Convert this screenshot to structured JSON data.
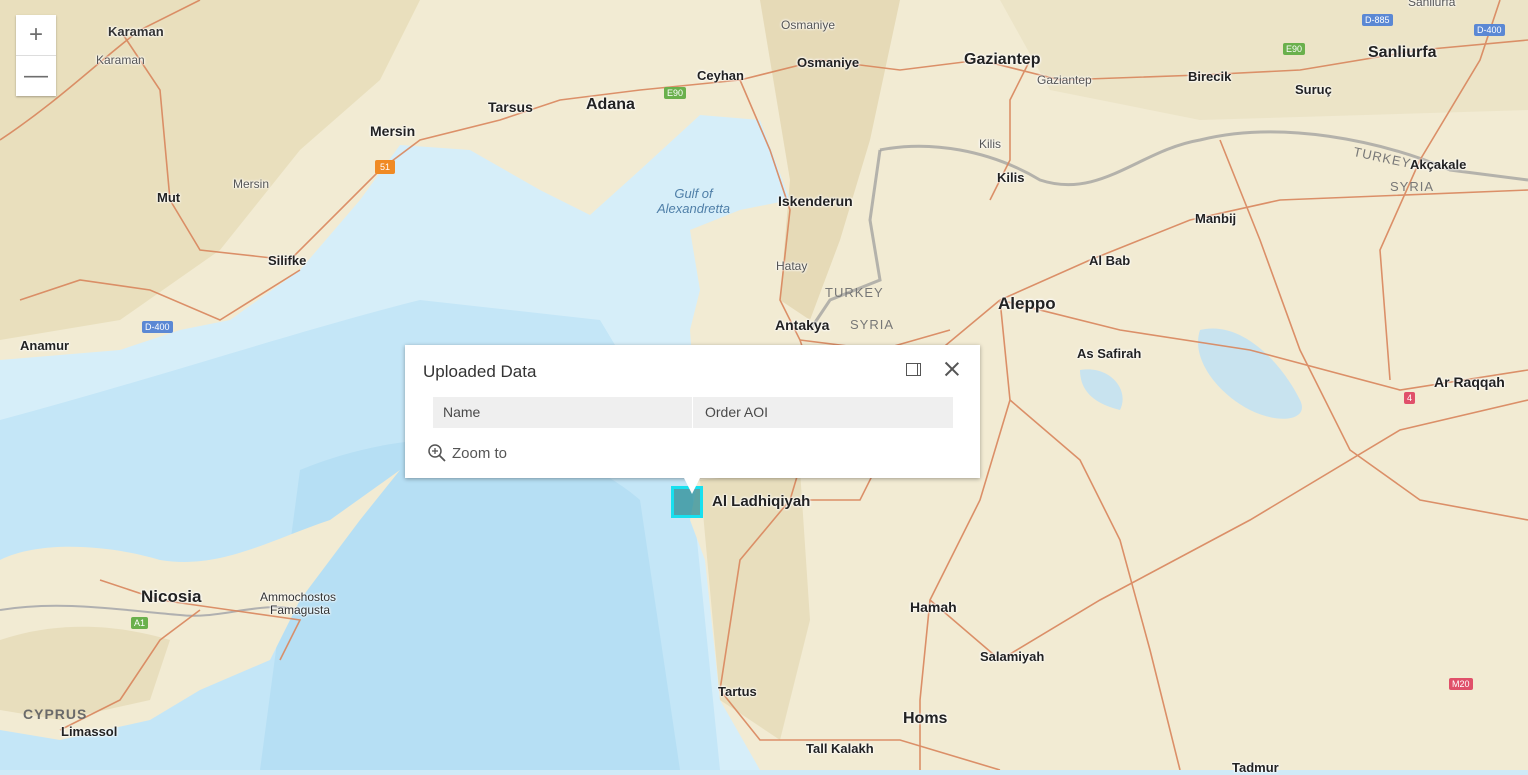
{
  "map": {
    "colors": {
      "land": "#f3ecd5",
      "sea": "#d6eef9",
      "deep_sea": "#b8e0f5",
      "road": "#d9865d",
      "mountain": "#e0d4b0",
      "border": "#9a9a9a",
      "aoi_fill": "#2a8c96",
      "aoi_outline": "#18e0ef"
    },
    "labels": {
      "karaman": "Karaman",
      "karaman_sub": "Karaman",
      "mersin": "Mersin",
      "mersin_sub": "Mersin",
      "tarsus": "Tarsus",
      "adana": "Adana",
      "ceyhan": "Ceyhan",
      "osmaniye_sub": "Osmaniye",
      "osmaniye": "Osmaniye",
      "gaziantep": "Gaziantep",
      "gaziantep_sub": "Gaziantep",
      "birecik": "Birecik",
      "sanliurfa": "Sanliurfa",
      "sanliurfa_sub": "Sanliurfa",
      "suruc": "Suruç",
      "mut": "Mut",
      "silifke": "Silifke",
      "anamur": "Anamur",
      "iskenderun": "Iskenderun",
      "hatay": "Hatay",
      "kilis_sub": "Kilis",
      "kilis": "Kilis",
      "turkey_east": "TURKEY",
      "akcakale": "Akçakale",
      "syria_east": "SYRIA",
      "manbij": "Manbij",
      "al_bab": "Al Bab",
      "aleppo": "Aleppo",
      "antakya": "Antakya",
      "turkey_mid": "TURKEY",
      "syria_mid": "SYRIA",
      "as_safirah": "As Safirah",
      "ar_raqqah": "Ar Raqqah",
      "al_ladhiqiyah": "Al Ladhiqiyah",
      "hamah": "Hamah",
      "salamiyah": "Salamiyah",
      "nicosia": "Nicosia",
      "ammochostos": "Ammochostos",
      "famagusta": "Famagusta",
      "cyprus": "CYPRUS",
      "limassol": "Limassol",
      "tartus": "Tartus",
      "homs": "Homs",
      "tall_kalakh": "Tall Kalakh",
      "tadmur": "Tadmur",
      "gulf_line1": "Gulf of",
      "gulf_line2": "Alexandretta"
    },
    "shields": {
      "d885": "D-885",
      "d400_ne": "D-400",
      "e90_ne": "E90",
      "e90_adana": "E90",
      "r51": "51",
      "d400_w": "D-400",
      "r4": "4",
      "m20": "M20",
      "a1": "A1"
    }
  },
  "zoom_controls": {
    "zoom_in": "+",
    "zoom_out": "—"
  },
  "popup": {
    "title": "Uploaded Data",
    "field_name": "Name",
    "field_value": "Order AOI",
    "zoom_to": "Zoom to"
  }
}
